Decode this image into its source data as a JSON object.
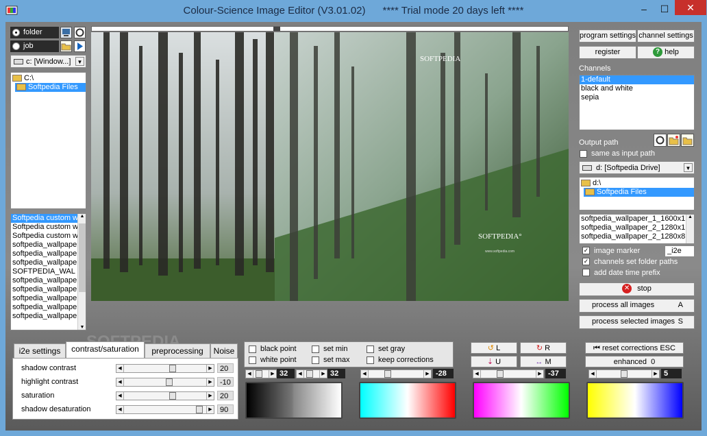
{
  "window": {
    "title": "Colour-Science Image Editor (V3.01.02)      **** Trial mode 20 days left ****",
    "minimize": "–",
    "maximize": "☐",
    "close": "✕"
  },
  "left": {
    "folder_radio": "folder",
    "job_radio": "job",
    "drive": "c: [Window...]",
    "tree": [
      "C:\\",
      "Softpedia Files"
    ],
    "files": [
      "Softpedia custom w",
      "Softpedia custom w",
      "Softpedia custom w",
      "softpedia_wallpape",
      "softpedia_wallpape",
      "softpedia_wallpape",
      "SOFTPEDIA_WAL",
      "softpedia_wallpape",
      "softpedia_wallpape",
      "softpedia_wallpape",
      "softpedia_wallpape",
      "softpedia_wallpape"
    ]
  },
  "image": {
    "watermark1": "SOFTPEDIA",
    "watermark2": "SOFTPEDIA°",
    "url": "www.softpedia.com"
  },
  "right": {
    "program_settings": "program settings",
    "channel_settings": "channel settings",
    "register": "register",
    "help": "help",
    "channels_label": "Channels",
    "channels": [
      "1-default",
      "black and white",
      "sepia"
    ],
    "output_label": "Output path",
    "same_as_input": "same as input path",
    "drive": "d: [Softpedia Drive]",
    "tree": [
      "d:\\",
      "Softpedia Files"
    ],
    "files": [
      "softpedia_wallpaper_1_1600x1",
      "softpedia_wallpaper_2_1280x1",
      "softpedia_wallpaper_2_1280x8"
    ],
    "image_marker": "image marker",
    "marker_value": "_i2e",
    "channels_folder": "channels set folder paths",
    "date_prefix": "add date time prefix",
    "stop": "stop",
    "process_all": "process all images",
    "process_all_key": "A",
    "process_selected": "process selected images",
    "process_selected_key": "S"
  },
  "bottom": {
    "tabs": [
      "i2e settings",
      "contrast/saturation",
      "preprocessing",
      "Noise"
    ],
    "sliders": [
      {
        "label": "shadow contrast",
        "value": "20",
        "pos": 0.6
      },
      {
        "label": "highlight contrast",
        "value": "-10",
        "pos": 0.55
      },
      {
        "label": "saturation",
        "value": "20",
        "pos": 0.6
      },
      {
        "label": "shadow desaturation",
        "value": "90",
        "pos": 0.95
      }
    ],
    "checks": {
      "black_point": "black point",
      "white_point": "white point",
      "set_min": "set min",
      "set_max": "set max",
      "set_gray": "set gray",
      "keep_corrections": "keep corrections"
    },
    "bw_values": [
      "32",
      "32"
    ],
    "cyan_red_value": "-28",
    "magenta_green_value": "-37",
    "yellow_blue_value": "5",
    "lurm": [
      "L",
      "R",
      "U",
      "M"
    ],
    "reset": "reset corrections ESC",
    "enhanced": "enhanced  0",
    "watermark": "SOFTPEDIA"
  },
  "colors": {
    "titlebar": "#6ea8d9",
    "select": "#3399ff",
    "close": "#c7302b"
  }
}
